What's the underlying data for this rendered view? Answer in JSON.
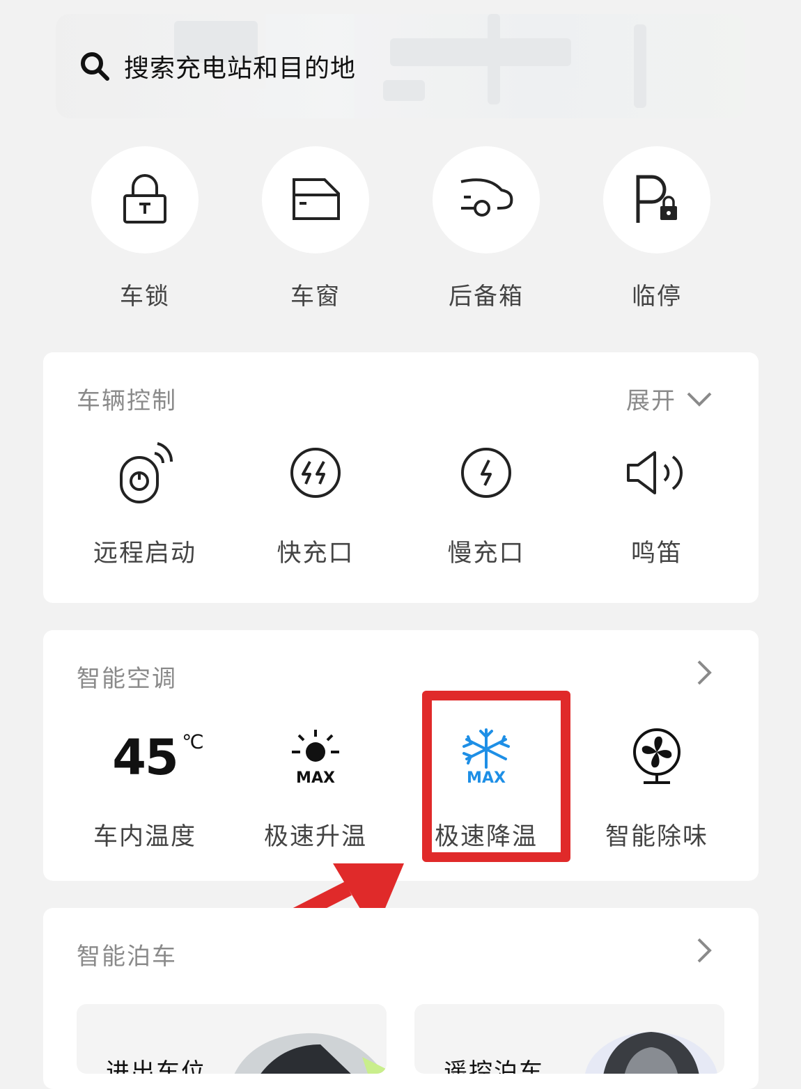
{
  "search": {
    "placeholder": "搜索充电站和目的地",
    "icon": "search-icon"
  },
  "quick_actions": [
    {
      "label": "车锁",
      "icon": "padlock-icon"
    },
    {
      "label": "车窗",
      "icon": "car-window-icon"
    },
    {
      "label": "后备箱",
      "icon": "trunk-icon"
    },
    {
      "label": "临停",
      "icon": "parking-lock-icon"
    }
  ],
  "vehicle_control": {
    "title": "车辆控制",
    "expand_label": "展开",
    "items": [
      {
        "label": "远程启动",
        "icon": "remote-start-icon"
      },
      {
        "label": "快充口",
        "icon": "fast-charge-port-icon"
      },
      {
        "label": "慢充口",
        "icon": "slow-charge-port-icon"
      },
      {
        "label": "鸣笛",
        "icon": "horn-icon"
      }
    ]
  },
  "smart_ac": {
    "title": "智能空调",
    "temperature": "45",
    "temperature_unit": "℃",
    "items": [
      {
        "label": "车内温度"
      },
      {
        "label": "极速升温",
        "icon": "sun-max-icon",
        "badge": "MAX"
      },
      {
        "label": "极速降温",
        "icon": "snowflake-max-icon",
        "badge": "MAX"
      },
      {
        "label": "智能除味",
        "icon": "fan-icon"
      }
    ]
  },
  "smart_parking": {
    "title": "智能泊车",
    "cards": [
      {
        "label": "进出车位"
      },
      {
        "label": "遥控泊车"
      }
    ]
  },
  "colors": {
    "accent_blue": "#1e8fe6",
    "highlight_red": "#e02a2a"
  }
}
